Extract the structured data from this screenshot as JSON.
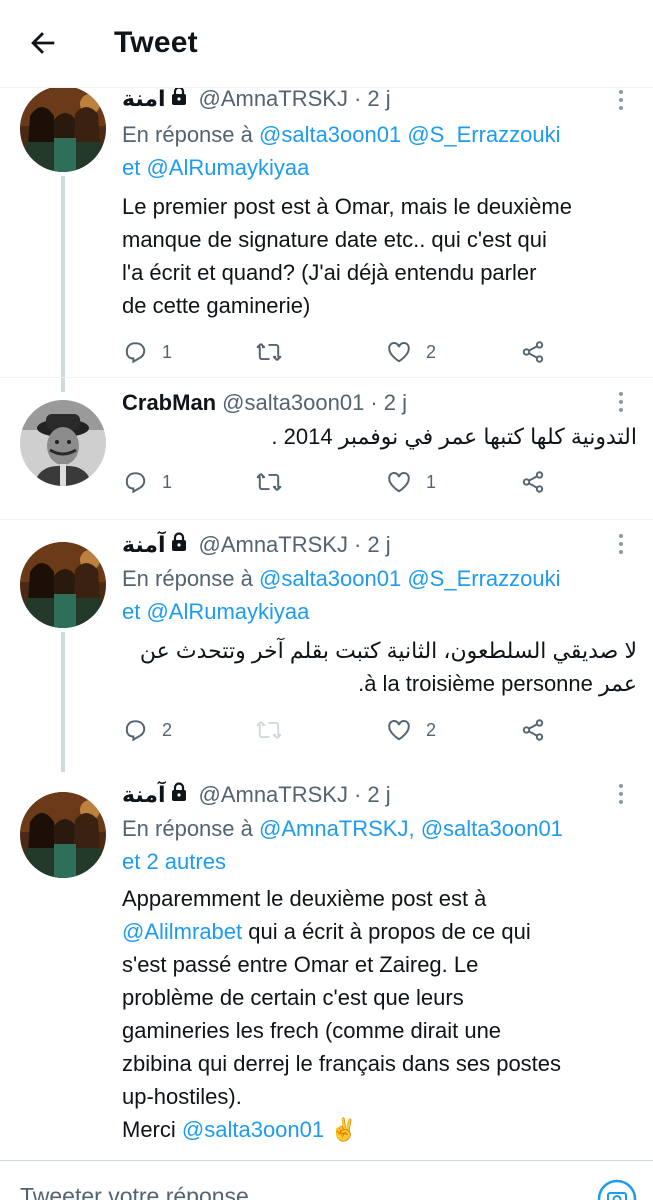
{
  "header": {
    "title": "Tweet"
  },
  "colors": {
    "link": "#1d9bf0",
    "muted": "#536471",
    "text": "#0f1419"
  },
  "tweets": [
    {
      "name": "آمنة",
      "locked": true,
      "handle": "@AmnaTRSKJ",
      "time": "· 2 j",
      "reply_prefix": "En réponse à",
      "reply_mentions": "@salta3oon01 @S_Errazzouki",
      "reply_conj": "",
      "reply_line2": "et @AlRumaykiyaa",
      "body_lines": [
        "Le premier post est à Omar, mais le deuxième",
        "manque de signature date etc.. qui c'est qui",
        "l'a écrit et quand?  (J'ai déjà entendu parler",
        "de cette gaminerie)"
      ],
      "replies": "1",
      "retweets": "",
      "likes": "2"
    },
    {
      "name": "CrabMan",
      "locked": false,
      "handle": "@salta3oon01",
      "time": "· 2 j",
      "body_lines": [
        "التدونية كلها كتبها عمر في نوفمبر 2014 ."
      ],
      "replies": "1",
      "retweets": "",
      "likes": "1"
    },
    {
      "name": "آمنة",
      "locked": true,
      "handle": "@AmnaTRSKJ",
      "time": "· 2 j",
      "reply_prefix": "En réponse à",
      "reply_mentions": "@salta3oon01 @S_Errazzouki",
      "reply_line2": "et @AlRumaykiyaa",
      "body_lines": [
        "لا صديقي السلطعون، الثانية كتبت بقلم آخر وتتحدث عن",
        "عمر à la troisième personne."
      ],
      "replies": "2",
      "retweets": "",
      "likes": "2"
    },
    {
      "name": "آمنة",
      "locked": true,
      "handle": "@AmnaTRSKJ",
      "time": "· 2 j",
      "reply_prefix": "En réponse à",
      "reply_mentions": "@AmnaTRSKJ, @salta3oon01",
      "reply_line2": "et 2 autres",
      "body_line1": "Apparemment le deuxième post est à",
      "body_mention": "@Alilmrabet",
      "body_line2_rest": " qui a écrit à propos de ce qui",
      "body_lines_rest": [
        "s'est passé entre Omar et Zaireg. Le",
        "problème de certain c'est que leurs",
        "gamineries les frech (comme dirait une",
        "zbibina qui derrej le français dans ses postes",
        "up-hostiles)."
      ],
      "merci": "Merci",
      "merci_mention": "@salta3oon01",
      "emoji": "✌️"
    }
  ],
  "composer": {
    "placeholder": "Tweeter votre réponse"
  }
}
